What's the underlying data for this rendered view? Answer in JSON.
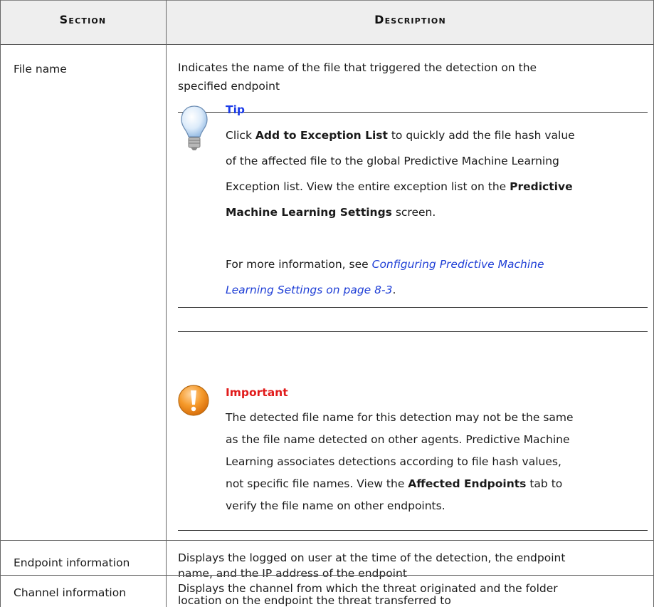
{
  "header": {
    "section": "Section",
    "description": "Description"
  },
  "rows": [
    {
      "section": "File name",
      "description_lines": [
        "Indicates the name of the file that triggered the detection on the",
        "specified endpoint"
      ],
      "tip": {
        "title": "Tip",
        "lines": [
          {
            "pre": "Click ",
            "bold": "Add to Exception List",
            "post": " to quickly add the file hash value"
          },
          {
            "text": "of the affected file to the global Predictive Machine Learning"
          },
          {
            "pre": "Exception list. View the entire exception list on the ",
            "bold": "Predictive"
          },
          {
            "bold": "Machine Learning Settings",
            "post": " screen."
          }
        ],
        "more_pre": "For more information, see ",
        "more_link_line1": "Configuring Predictive Machine",
        "more_link_line2": "Learning Settings on page 8-3",
        "more_post": "."
      },
      "important": {
        "title": "Important",
        "lines": [
          "The detected file name for this detection may not be the same",
          "as the file name detected on other agents. Predictive Machine",
          "Learning associates detections according to file hash values,"
        ],
        "last_pre": "not specific file names. View the ",
        "last_bold": "Affected Endpoints",
        "last_post": " tab to",
        "final_line": "verify the file name on other endpoints."
      }
    },
    {
      "section": "Endpoint information",
      "description_lines": [
        "Displays the logged on user at the time of the detection, the endpoint",
        "name, and the IP address of the endpoint"
      ]
    },
    {
      "section": "Channel information",
      "description_lines": [
        "Displays the channel from which the threat originated and the folder",
        "location on the endpoint the threat transferred to"
      ]
    }
  ],
  "colors": {
    "tip": "#1b3be8",
    "important": "#e11b1b",
    "link": "#1f3fd6",
    "header_bg": "#eeeeee"
  }
}
